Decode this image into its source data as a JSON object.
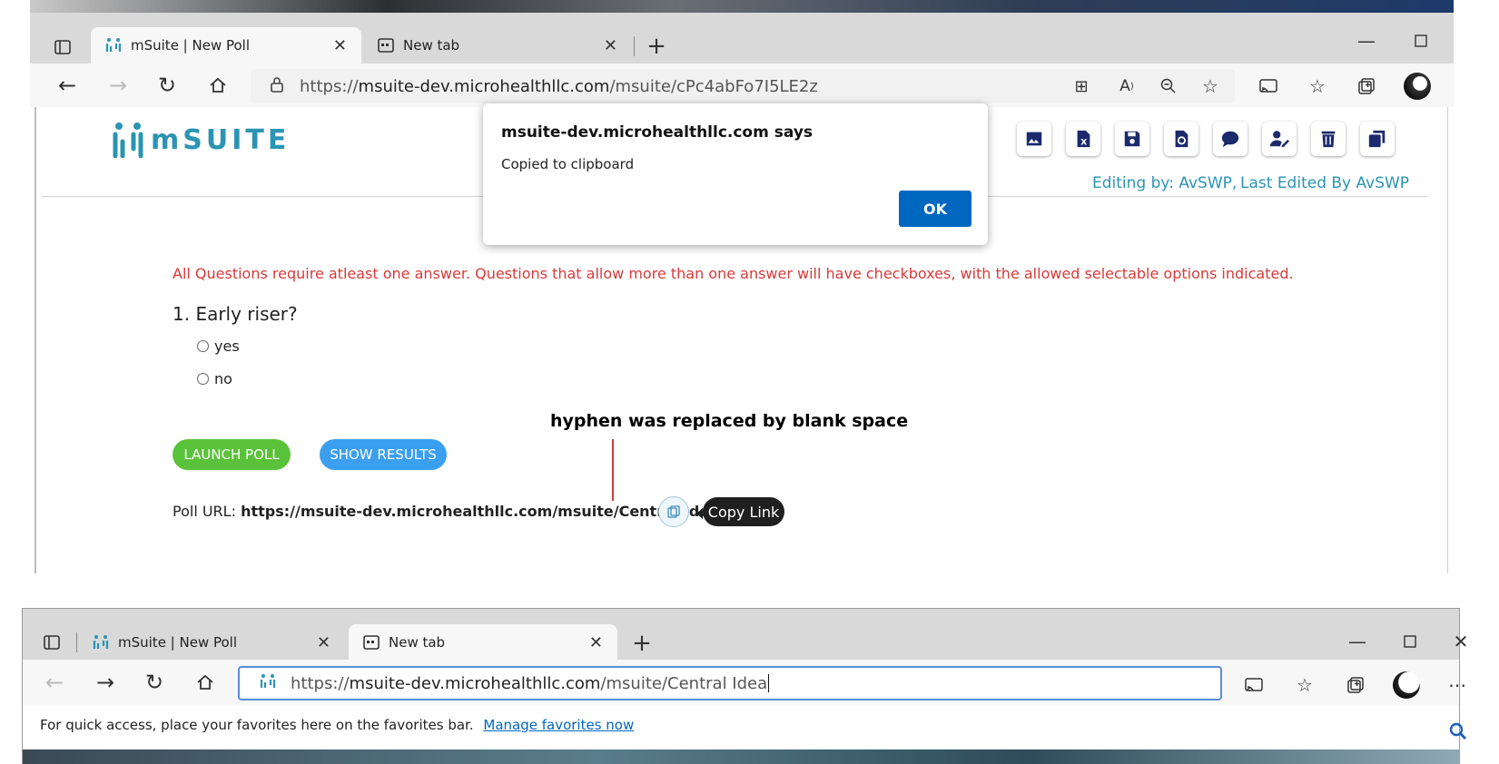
{
  "window1": {
    "tabs": [
      {
        "label": "mSuite | New Poll",
        "active": true
      },
      {
        "label": "New tab",
        "active": false
      }
    ],
    "url": {
      "scheme": "https://",
      "host": "msuite-dev.microhealthllc.com",
      "path": "/msuite/cPc4abFo7I5LE2z"
    }
  },
  "page": {
    "logo_text": "mSUITE",
    "editing_by": "Editing by: AvSWP,",
    "last_edited": "Last Edited By AvSWP",
    "warning": "All Questions require atleast one answer. Questions that allow more than one answer will have checkboxes, with the allowed selectable options indicated.",
    "question": "1. Early riser?",
    "options": [
      "yes",
      "no"
    ],
    "launch_label": "LAUNCH POLL",
    "results_label": "SHOW RESULTS",
    "poll_url_label": "Poll URL:",
    "poll_url_value": "https://msuite-dev.microhealthllc.com/msuite/Central Idea",
    "copy_tooltip": "Copy Link",
    "annotation": "hyphen was replaced by blank space",
    "colors": {
      "accent": "#2b94b3",
      "launch": "#5ac23a",
      "results": "#3b9ff0",
      "warning": "#d93a3a"
    }
  },
  "dialog": {
    "title": "msuite-dev.microhealthllc.com says",
    "message": "Copied to clipboard",
    "ok_label": "OK"
  },
  "window2": {
    "tabs": [
      {
        "label": "mSuite | New Poll",
        "active": false
      },
      {
        "label": "New tab",
        "active": true
      }
    ],
    "url": {
      "scheme": "https://",
      "host": "msuite-dev.microhealthllc.com",
      "path": "/msuite/Central Idea"
    },
    "favbar_text": "For quick access, place your favorites here on the favorites bar.",
    "favbar_link": "Manage favorites now"
  }
}
